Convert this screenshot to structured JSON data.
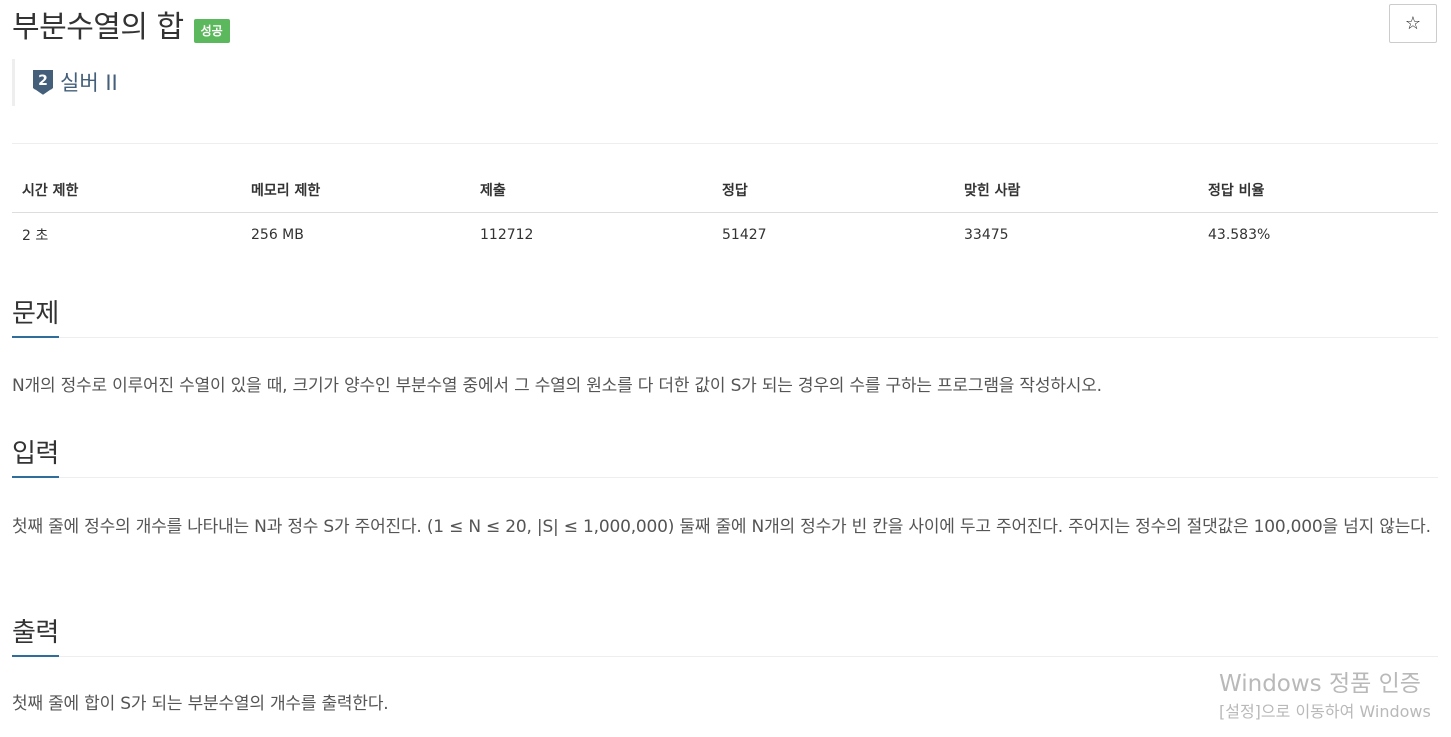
{
  "problem": {
    "title": "부분수열의 합",
    "status_badge": "성공",
    "star_glyph": "☆",
    "tier_number": "2",
    "tier_label": "실버 II",
    "tier_color": "#435f7a",
    "badge_color": "#5cb85c"
  },
  "info_table": {
    "headers": [
      "시간 제한",
      "메모리 제한",
      "제출",
      "정답",
      "맞힌 사람",
      "정답 비율"
    ],
    "values": [
      "2 초",
      "256 MB",
      "112712",
      "51427",
      "33475",
      "43.583%"
    ]
  },
  "sections": {
    "description": {
      "title": "문제",
      "text": "N개의 정수로 이루어진 수열이 있을 때, 크기가 양수인 부분수열 중에서 그 수열의 원소를 다 더한 값이 S가 되는 경우의 수를 구하는 프로그램을 작성하시오."
    },
    "input": {
      "title": "입력",
      "text": "첫째 줄에 정수의 개수를 나타내는 N과 정수 S가 주어진다. (1 ≤ N ≤ 20, |S| ≤ 1,000,000) 둘째 줄에 N개의 정수가 빈 칸을 사이에 두고 주어진다. 주어지는 정수의 절댓값은 100,000을 넘지 않는다."
    },
    "output": {
      "title": "출력",
      "text": "첫째 줄에 합이 S가 되는 부분수열의 개수를 출력한다."
    }
  },
  "watermark": {
    "line1": "Windows 정품 인증",
    "line2": "[설정]으로 이동하여 Windows"
  }
}
